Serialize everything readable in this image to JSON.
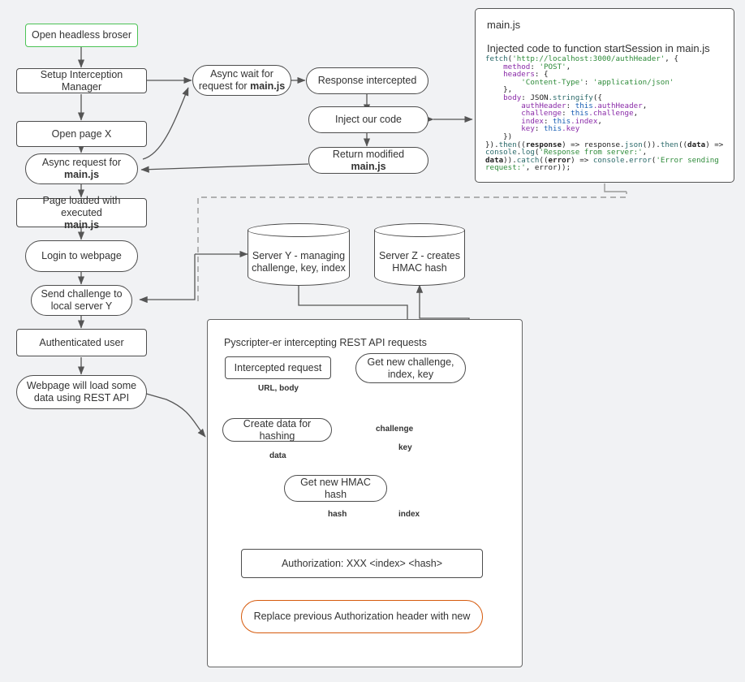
{
  "diagram": {
    "title": "Headless browser interception and HMAC authorization flow",
    "background_color": "#f1f2f4",
    "accent_start_color": "#4cc355",
    "accent_end_color": "#d65a0c"
  },
  "left_flow": [
    {
      "id": "open-headless-browser",
      "label": "Open headless broser",
      "shape": "rect",
      "accent": "green"
    },
    {
      "id": "setup-interception-manager",
      "label": "Setup Interception Manager",
      "shape": "rect"
    },
    {
      "id": "open-page-x",
      "label": "Open page X",
      "shape": "rect"
    },
    {
      "id": "async-request-mainjs",
      "label_html": "Async request for<br><b>main.js</b>",
      "shape": "stadium"
    },
    {
      "id": "page-loaded-mainjs",
      "label_html": "Page loaded with executed<br><b>main.js</b>",
      "shape": "rect"
    },
    {
      "id": "login-to-webpage",
      "label": "Login to webpage",
      "shape": "stadium"
    },
    {
      "id": "send-challenge-server-y",
      "label_html": "Send challenge to<br>local server Y",
      "shape": "stadium"
    },
    {
      "id": "authenticated-user",
      "label": "Authenticated user",
      "shape": "rect"
    },
    {
      "id": "webpage-load-rest",
      "label_html": "Webpage will load some<br>data using REST API",
      "shape": "stadium"
    }
  ],
  "interception_flow": [
    {
      "id": "async-wait-request",
      "label_html": "Async wait for<br>request for <b>main.js</b>",
      "shape": "stadium"
    },
    {
      "id": "response-intercepted",
      "label": "Response intercepted",
      "shape": "stadium"
    },
    {
      "id": "inject-our-code",
      "label": "Inject our code",
      "shape": "stadium"
    },
    {
      "id": "return-modified-mainjs",
      "label_html": "Return modified <b>main.js</b>",
      "shape": "stadium"
    }
  ],
  "servers": [
    {
      "id": "server-y",
      "label_html": "Server Y - managing<br>challenge, key, index"
    },
    {
      "id": "server-z",
      "label_html": "Server Z - creates<br>HMAC hash"
    }
  ],
  "code_panel": {
    "title": "main.js",
    "subtitle": "Injected code to function startSession in main.js",
    "code": "fetch('http://localhost:3000/authHeader', {\n    method: 'POST',\n    headers: {\n        'Content-Type': 'application/json'\n    },\n    body: JSON.stringify({\n        authHeader: this.authHeader,\n        challenge: this.challenge,\n        index: this.index,\n        key: this.key\n    })\n}).then((response) => response.json()).then((data) => console.log('Response from server:', data)).catch((error) => console.error('Error sending request:', error));"
  },
  "rest_group": {
    "title": "Pyscripter-er intercepting REST API requests",
    "nodes": [
      {
        "id": "intercepted-request",
        "label": "Intercepted request",
        "shape": "rect"
      },
      {
        "id": "get-new-challenge",
        "label_html": "Get new challenge,<br>index, key",
        "shape": "stadium"
      },
      {
        "id": "create-data-hashing",
        "label": "Create data for hashing",
        "shape": "stadium"
      },
      {
        "id": "get-new-hmac-hash",
        "label": "Get new HMAC hash",
        "shape": "stadium"
      },
      {
        "id": "authorization-header",
        "label": "Authorization: XXX <index> <hash>",
        "shape": "rect"
      },
      {
        "id": "replace-auth-header",
        "label": "Replace previous Authorization header with new",
        "shape": "stadium",
        "accent": "orange"
      }
    ],
    "edge_labels": [
      {
        "id": "url-body",
        "text": "URL, body"
      },
      {
        "id": "challenge",
        "text": "challenge"
      },
      {
        "id": "key",
        "text": "key"
      },
      {
        "id": "data",
        "text": "data"
      },
      {
        "id": "hash",
        "text": "hash"
      },
      {
        "id": "index",
        "text": "index"
      }
    ]
  }
}
